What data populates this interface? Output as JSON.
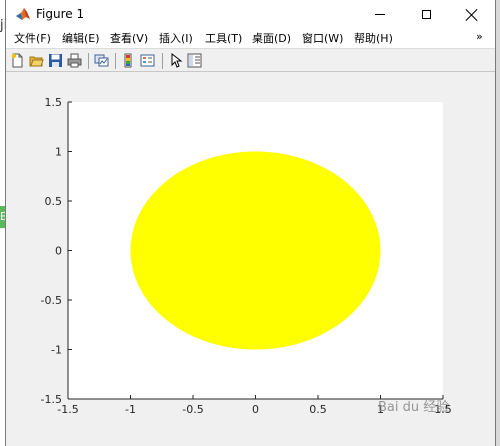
{
  "window": {
    "title": "Figure 1"
  },
  "background": {
    "left_char": "ji",
    "green_tab_char": "B"
  },
  "menu": {
    "items": [
      "文件(F)",
      "编辑(E)",
      "查看(V)",
      "插入(I)",
      "工具(T)",
      "桌面(D)",
      "窗口(W)",
      "帮助(H)"
    ],
    "overflow_glyph": "»"
  },
  "toolbar": {
    "icons": [
      "new-figure-icon",
      "open-file-icon",
      "save-icon",
      "print-icon",
      "link-plot-icon",
      "insert-colorbar-icon",
      "insert-legend-icon",
      "edit-plot-icon",
      "property-inspector-icon"
    ]
  },
  "colors": {
    "fill": "#ffff00",
    "axes_background": "#ffffff",
    "figure_background": "#f0f0f0"
  },
  "chart_data": {
    "type": "scatter",
    "shape": "filled ellipse",
    "center": [
      0,
      0
    ],
    "radius_x": 1,
    "radius_y": 1,
    "xlim": [
      -1.5,
      1.5
    ],
    "ylim": [
      -1.5,
      1.5
    ],
    "xticks": [
      -1.5,
      -1,
      -0.5,
      0,
      0.5,
      1,
      1.5
    ],
    "yticks": [
      -1.5,
      -1,
      -0.5,
      0,
      0.5,
      1,
      1.5
    ],
    "xtick_labels": [
      "-1.5",
      "-1",
      "-0.5",
      "0",
      "0.5",
      "1",
      "1.5"
    ],
    "ytick_labels": [
      "-1.5",
      "-1",
      "-0.5",
      "0",
      "0.5",
      "1",
      "1.5"
    ],
    "title": "",
    "xlabel": "",
    "ylabel": "",
    "grid": false,
    "box": false
  },
  "watermark": "Bai du 经验"
}
